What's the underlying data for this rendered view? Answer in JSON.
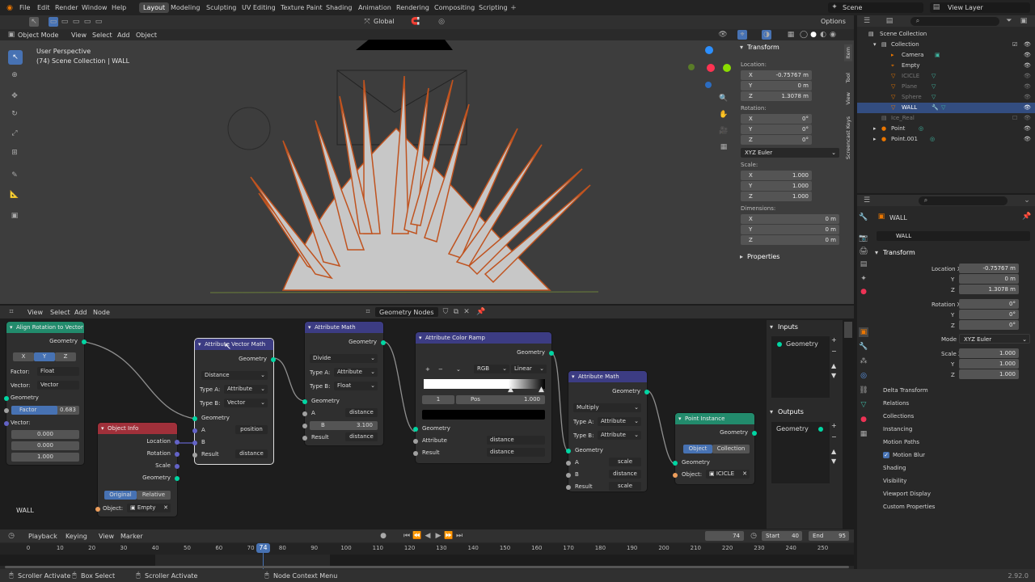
{
  "topbar": {
    "menus": [
      "File",
      "Edit",
      "Render",
      "Window",
      "Help"
    ],
    "workspaces": [
      "Layout",
      "Modeling",
      "Sculpting",
      "UV Editing",
      "Texture Paint",
      "Shading",
      "Animation",
      "Rendering",
      "Compositing",
      "Scripting"
    ],
    "scene": "Scene",
    "view_layer": "View Layer"
  },
  "viewport": {
    "mode": "Object Mode",
    "menus": [
      "View",
      "Select",
      "Add",
      "Object"
    ],
    "orientation": "Global",
    "options": "Options",
    "info_line1": "User Perspective",
    "info_line2": "(74) Scene Collection | WALL",
    "object_label": "WALL"
  },
  "npanel": {
    "title": "Transform",
    "location_label": "Location:",
    "location": [
      "-0.75767 m",
      "0 m",
      "1.3078 m"
    ],
    "rotation_label": "Rotation:",
    "rotation": [
      "0°",
      "0°",
      "0°"
    ],
    "rotation_mode": "XYZ Euler",
    "scale_label": "Scale:",
    "scale": [
      "1.000",
      "1.000",
      "1.000"
    ],
    "dimensions_label": "Dimensions:",
    "dimensions": [
      "0 m",
      "0 m",
      "0 m"
    ],
    "properties": "Properties",
    "tabs": [
      "Item",
      "Tool",
      "View",
      "Screencast Keys"
    ],
    "axes": [
      "X",
      "Y",
      "Z"
    ]
  },
  "outliner": {
    "items": [
      "Scene Collection",
      "Collection",
      "Camera",
      "Empty",
      "ICICLE",
      "Plane",
      "Sphere",
      "WALL",
      "Ice_Real",
      "Point",
      "Point.001"
    ]
  },
  "properties": {
    "object_name": "WALL",
    "datablock": "WALL",
    "transform": "Transform",
    "location_x_label": "Location X",
    "rotation_x_label": "Rotation X",
    "mode_label": "Mode",
    "mode": "XYZ Euler",
    "scale_x_label": "Scale X",
    "location": [
      "-0.75767 m",
      "0 m",
      "1.3078 m"
    ],
    "rotation": [
      "0°",
      "0°",
      "0°"
    ],
    "scale": [
      "1.000",
      "1.000",
      "1.000"
    ],
    "sections": [
      "Delta Transform",
      "Relations",
      "Collections",
      "Instancing",
      "Motion Paths",
      "Motion Blur",
      "Shading",
      "Visibility",
      "Viewport Display",
      "Custom Properties"
    ],
    "y_label": "Y",
    "z_label": "Z"
  },
  "node_editor": {
    "menus": [
      "View",
      "Select",
      "Add",
      "Node"
    ],
    "tree": "Geometry Nodes",
    "object_label": "WALL",
    "inputs_title": "Inputs",
    "outputs_title": "Outputs",
    "input_item": "Geometry",
    "output_item": "Geometry",
    "nodes": {
      "align": {
        "title": "Align Rotation to Vector",
        "out": "Geometry",
        "axes": [
          "X",
          "Y",
          "Z"
        ],
        "factor_label": "Factor:",
        "factor_mode": "Float",
        "vector_label": "Vector:",
        "vector_mode": "Vector",
        "in_geo": "Geometry",
        "factor": "Factor",
        "factor_val": "0.683",
        "vector_in": "Vector:",
        "vec": [
          "0.000",
          "0.000",
          "1.000"
        ]
      },
      "objinfo": {
        "title": "Object Info",
        "outs": [
          "Location",
          "Rotation",
          "Scale",
          "Geometry"
        ],
        "original": "Original",
        "relative": "Relative",
        "object_label": "Object:",
        "object": "Empty"
      },
      "avm": {
        "title": "Attribute Vector Math",
        "out": "Geometry",
        "op": "Distance",
        "type_a_label": "Type A:",
        "type_a": "Attribute",
        "type_b_label": "Type B:",
        "type_b": "Vector",
        "in_geo": "Geometry",
        "a": "A",
        "a_val": "position",
        "b": "B",
        "result": "Result",
        "result_val": "distance"
      },
      "am1": {
        "title": "Attribute Math",
        "out": "Geometry",
        "op": "Divide",
        "type_a_label": "Type A:",
        "type_a": "Attribute",
        "type_b_label": "Type B:",
        "type_b": "Float",
        "in_geo": "Geometry",
        "a": "A",
        "a_val": "distance",
        "b": "B",
        "b_val": "3.100",
        "result": "Result",
        "result_val": "distance"
      },
      "ramp": {
        "title": "Attribute Color Ramp",
        "out": "Geometry",
        "color_mode": "RGB",
        "interp": "Linear",
        "index": "1",
        "pos_label": "Pos",
        "pos": "1.000",
        "in_geo": "Geometry",
        "attr_label": "Attribute",
        "attr": "distance",
        "result_label": "Result",
        "result": "distance"
      },
      "am2": {
        "title": "Attribute Math",
        "out": "Geometry",
        "op": "Multiply",
        "type_a_label": "Type A:",
        "type_a": "Attribute",
        "type_b_label": "Type B:",
        "type_b": "Attribute",
        "in_geo": "Geometry",
        "a": "A",
        "a_val": "scale",
        "b": "B",
        "b_val": "distance",
        "result": "Result",
        "result_val": "scale"
      },
      "pi": {
        "title": "Point Instance",
        "out": "Geometry",
        "object": "Object",
        "collection": "Collection",
        "in_geo": "Geometry",
        "object_label": "Object:",
        "object_val": "ICICLE"
      }
    }
  },
  "timeline": {
    "menus": [
      "Playback",
      "Keying",
      "View",
      "Marker"
    ],
    "current": "74",
    "start_label": "Start",
    "start": "40",
    "end_label": "End",
    "end": "95",
    "ticks": [
      "0",
      "10",
      "20",
      "30",
      "40",
      "50",
      "60",
      "70",
      "80",
      "90",
      "100",
      "110",
      "120",
      "130",
      "140",
      "150",
      "160",
      "170",
      "180",
      "190",
      "200",
      "210",
      "220",
      "230",
      "240",
      "250"
    ]
  },
  "statusbar": {
    "items": [
      "Scroller Activate",
      "Box Select",
      "Scroller Activate",
      "Node Context Menu"
    ],
    "version": "2.92.0"
  },
  "colors": {
    "accent": "#4772b3",
    "active_tab": "#474747",
    "node_geometry_socket": "#00d6a3",
    "selection": "#334d80"
  }
}
